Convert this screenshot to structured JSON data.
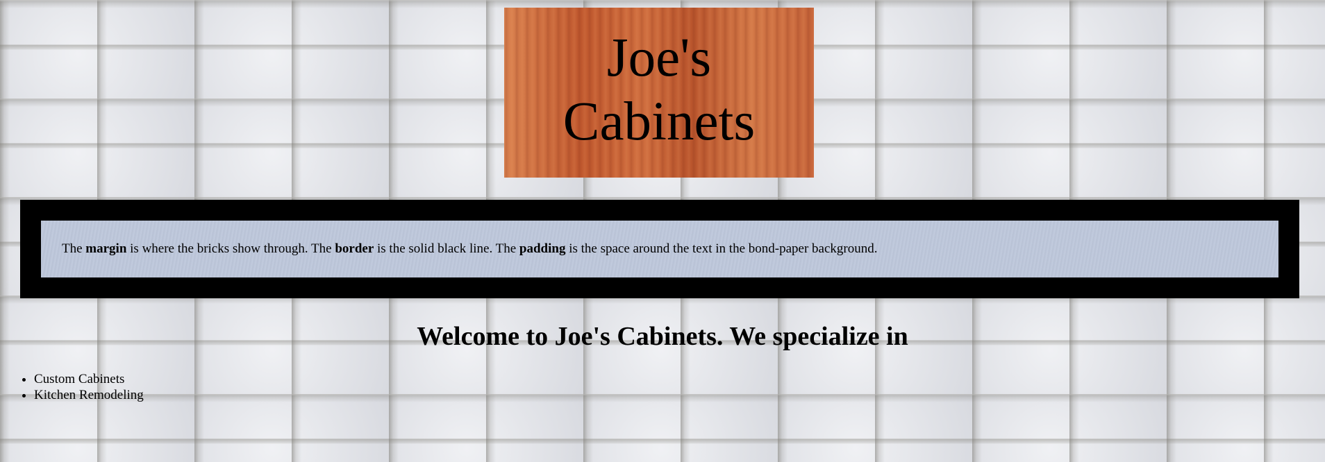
{
  "logo": {
    "line1": "Joe's",
    "line2": "Cabinets"
  },
  "notice": {
    "part1": "The ",
    "term1": "margin",
    "part2": " is where the bricks show through. The ",
    "term2": "border",
    "part3": " is the solid black line. The ",
    "term3": "padding",
    "part4": " is the space around the text in the bond-paper background."
  },
  "welcome": {
    "heading": "Welcome to Joe's Cabinets. We specialize in"
  },
  "services": {
    "items": [
      {
        "label": "Custom Cabinets"
      },
      {
        "label": "Kitchen Remodeling"
      }
    ]
  },
  "colors": {
    "wall": "#e3e4e8",
    "logo_wood": "#c9653a",
    "border": "#000000",
    "paper": "#bec8dc"
  }
}
